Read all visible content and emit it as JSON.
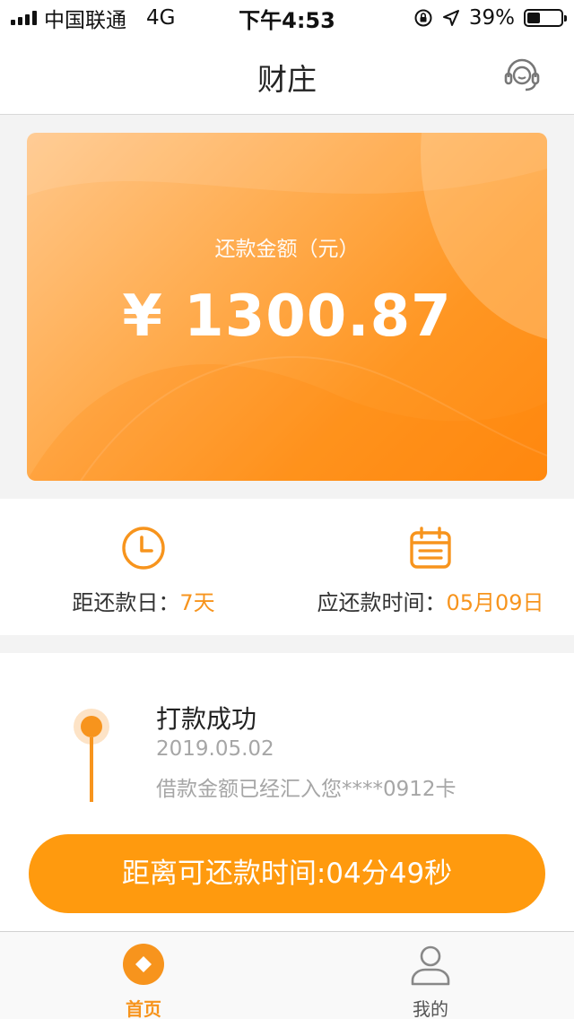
{
  "status_bar": {
    "carrier": "中国联通",
    "network": "4G",
    "time": "下午4:53",
    "battery_percent": "39%",
    "battery_level": 0.39
  },
  "header": {
    "title": "财庄",
    "service_icon": "headset-icon"
  },
  "card": {
    "label": "还款金额（元）",
    "amount": "¥ 1300.87"
  },
  "info": {
    "days_label": "距还款日：",
    "days_value": "7天",
    "date_label": "应还款时间：",
    "date_value": "05月09日"
  },
  "progress": {
    "title": "打款成功",
    "date": "2019.05.02",
    "desc": "借款金额已经汇入您****0912卡"
  },
  "countdown_button": "距离可还款时间:04分49秒",
  "tabs": [
    {
      "label": "首页",
      "icon": "home-icon",
      "active": true
    },
    {
      "label": "我的",
      "icon": "user-icon",
      "active": false
    }
  ],
  "colors": {
    "accent": "#f7941d",
    "button": "#ff9a0e",
    "card_start": "#ffc78a",
    "card_end": "#ff8a12"
  }
}
